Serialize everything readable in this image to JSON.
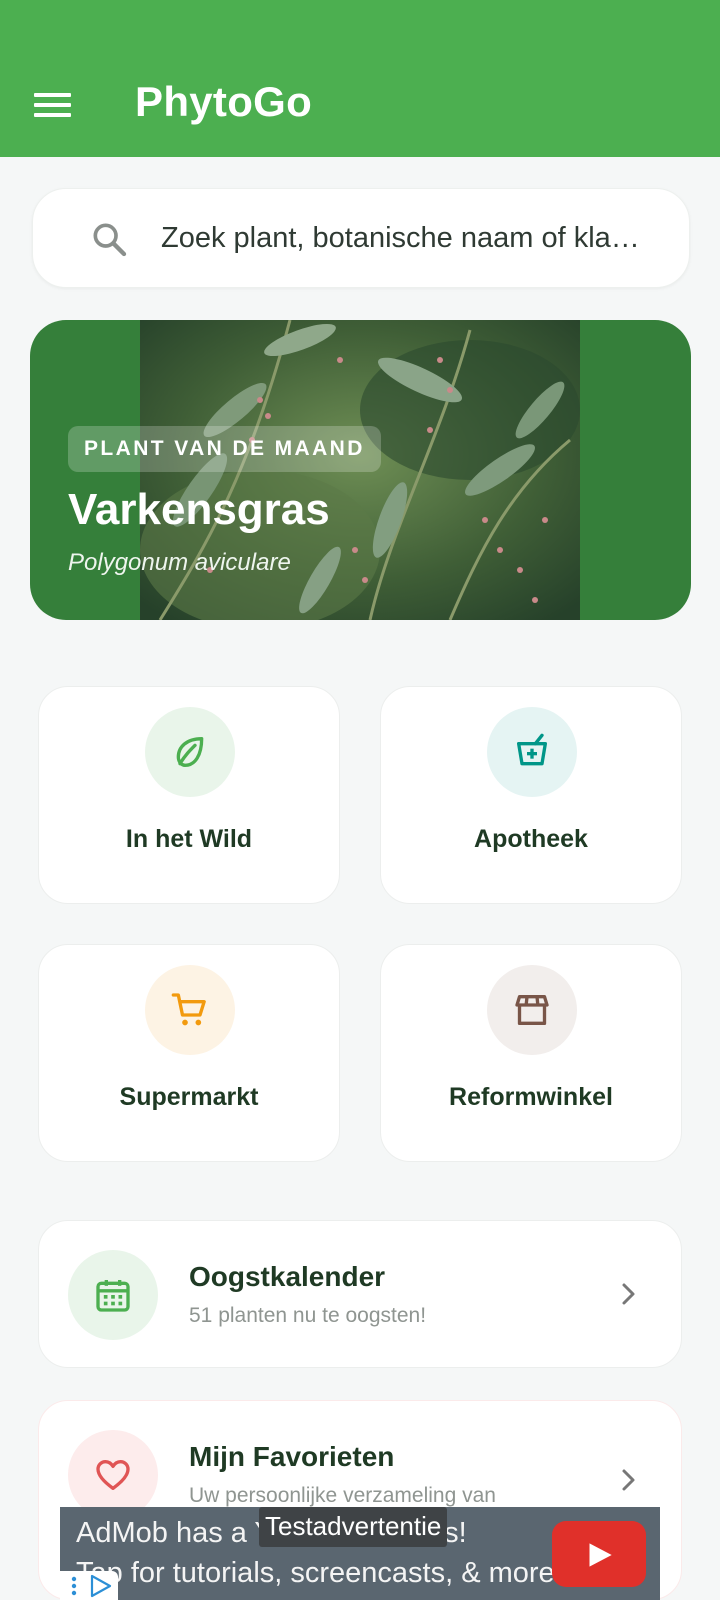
{
  "app_bar": {
    "title": "PhytoGo",
    "color": "#4caf50"
  },
  "search": {
    "placeholder": "Zoek plant, botanische naam of kla…"
  },
  "featured": {
    "badge": "PLANT VAN DE MAAND",
    "name": "Varkensgras",
    "latin_name": "Polygonum aviculare"
  },
  "tiles": [
    {
      "label": "In het Wild",
      "icon": "leaf-icon",
      "color": "#4caf50"
    },
    {
      "label": "Apotheek",
      "icon": "mortar-pestle-icon",
      "color": "#009688"
    },
    {
      "label": "Supermarkt",
      "icon": "shopping-cart-icon",
      "color": "#f29a0e"
    },
    {
      "label": "Reformwinkel",
      "icon": "storefront-icon",
      "color": "#795548"
    }
  ],
  "harvest": {
    "title": "Oogstkalender",
    "subtitle": "51 planten nu te oogsten!",
    "icon": "calendar-icon"
  },
  "favorites": {
    "title": "Mijn Favorieten",
    "subtitle": "Uw persoonlijke verzameling van",
    "icon": "heart-icon"
  },
  "ad": {
    "label": "Testadvertentie",
    "line1": "AdMob has a YouTube Series!",
    "line2": "Tap for tutorials, screencasts, & more.",
    "icon": "youtube-play-icon"
  }
}
